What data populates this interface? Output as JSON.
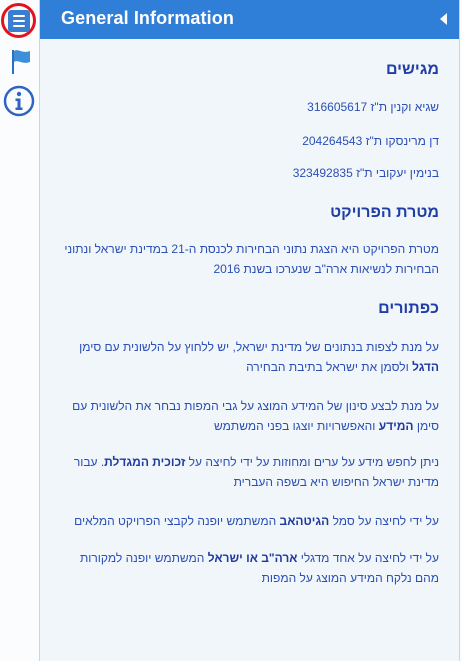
{
  "panel": {
    "title": "General Information"
  },
  "toolbar": {
    "menu_icon": "hamburger-menu-icon",
    "flag_icon": "flag-icon",
    "info_icon": "info-icon"
  },
  "sections": {
    "presenters": {
      "heading": "מגישים",
      "people": [
        "שגיא וקנין ת\"ז 316605617",
        "דן מרינסקו ת\"ז 204264543",
        "בנימין יעקובי ת\"ז 323492835"
      ]
    },
    "goal": {
      "heading": "מטרת הפרויקט",
      "text": "מטרת הפרויקט היא הצגת נתוני הבחירות לכנסת ה-21 במדינת ישראל ונתוני הבחירות לנשיאות ארה\"ב שנערכו בשנת 2016"
    },
    "buttons": {
      "heading": "כפתורים",
      "items": [
        {
          "pre": "על מנת לצפות בנתונים של מדינת ישראל, יש ללחוץ על הלשונית עם סימן ",
          "bold": "הדגל",
          "post": " ולסמן את ישראל בתיבת הבחירה"
        },
        {
          "pre": "על מנת לבצע סינון של המידע המוצג על גבי המפות נבחר את הלשונית עם סימן ",
          "bold": "המידע",
          "post": " והאפשרויות יוצגו בפני המשתמש"
        },
        {
          "pre": "ניתן לחפש מידע על ערים ומחוזות על ידי לחיצה על ",
          "bold": "זכוכית המגדלת",
          "post": ". עבור מדינת ישראל החיפוש היא בשפה העברית"
        },
        {
          "pre": "על ידי לחיצה על סמל ",
          "bold": "הגיטהאב",
          "post": " המשתמש יופנה לקבצי הפרויקט המלאים"
        },
        {
          "pre": "על ידי לחיצה על אחד מדגלי ",
          "bold": "ארה\"ב או ישראל",
          "post": " המשתמש יופנה למקורות מהם נלקח המידע המוצג על המפות"
        }
      ]
    }
  },
  "colors": {
    "header_bg": "#2f7ed8",
    "accent_red": "#e4131b",
    "text_blue": "#2b4fb5"
  }
}
